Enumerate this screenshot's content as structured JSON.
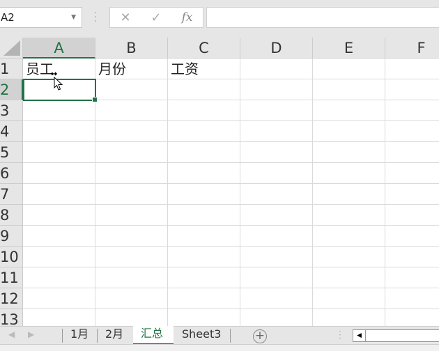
{
  "formula_bar": {
    "name_box": "A2",
    "cancel_icon": "✕",
    "enter_icon": "✓",
    "fx_label": "fx",
    "value": ""
  },
  "columns": [
    "A",
    "B",
    "C",
    "D",
    "E",
    "F"
  ],
  "rows": [
    "1",
    "2",
    "3",
    "4",
    "5",
    "6",
    "7",
    "8",
    "9",
    "10",
    "11",
    "12",
    "13"
  ],
  "cells": {
    "A1": "员工",
    "B1": "月份",
    "C1": "工资"
  },
  "selected_cell": "A2",
  "sheet_tabs": [
    {
      "label": "1月"
    },
    {
      "label": "2月"
    },
    {
      "label": "汇总",
      "active": true
    },
    {
      "label": "Sheet3"
    }
  ],
  "accent": "#217346"
}
